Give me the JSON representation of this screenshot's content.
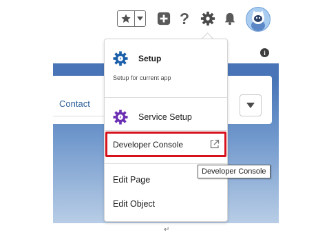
{
  "header": {
    "icons": [
      "star-icon",
      "chevron-down-icon",
      "plus-icon",
      "help-icon",
      "gear-icon",
      "bell-icon",
      "avatar"
    ],
    "help_label": "?"
  },
  "record": {
    "tab_label": "Contact"
  },
  "menu": {
    "setup_title": "Setup",
    "setup_subtitle": "Setup for current app",
    "service_setup": "Service Setup",
    "developer_console": "Developer Console",
    "edit_page": "Edit Page",
    "edit_object": "Edit Object"
  },
  "tooltip": {
    "text": "Developer Console"
  },
  "info_icon_glyph": "i",
  "return_mark": "↵",
  "colors": {
    "highlight": "#d6121c",
    "brand_blue": "#1b5faa",
    "service_purple": "#6b2fb3"
  }
}
